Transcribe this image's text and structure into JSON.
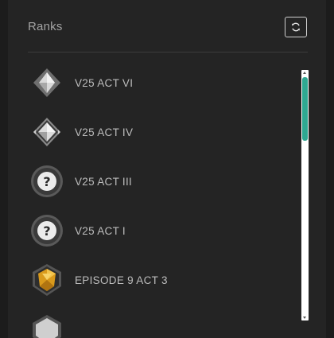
{
  "panel": {
    "title": "Ranks",
    "refresh_icon": "refresh-icon"
  },
  "ranks": [
    {
      "label": "V25 ACT VI",
      "icon": "diamond-rank-icon"
    },
    {
      "label": "V25 ACT IV",
      "icon": "diamond-rank-icon"
    },
    {
      "label": "V25 ACT III",
      "icon": "unknown-rank-icon"
    },
    {
      "label": "V25 ACT I",
      "icon": "unknown-rank-icon"
    },
    {
      "label": "EPISODE 9 ACT 3",
      "icon": "gold-rank-icon"
    }
  ],
  "colors": {
    "accent": "#2fa892",
    "gold": "#d99a1c"
  }
}
